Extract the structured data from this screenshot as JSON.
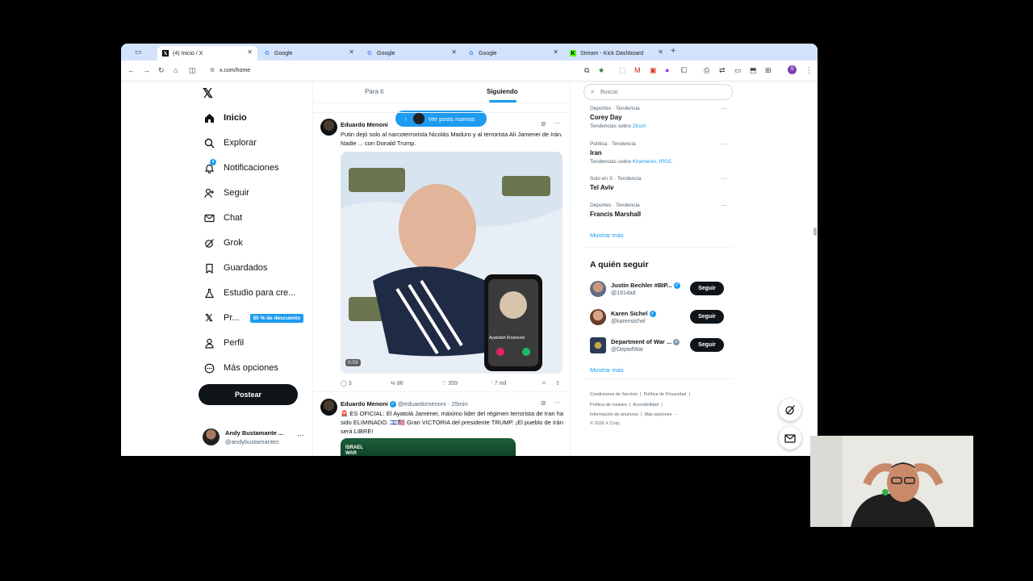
{
  "browser": {
    "tabs": [
      {
        "label": "(4) Inicio / X",
        "icon": "x-logo-icon",
        "active": true
      },
      {
        "label": "Google",
        "icon": "google-icon"
      },
      {
        "label": "Google",
        "icon": "google-icon"
      },
      {
        "label": "Google",
        "icon": "google-icon"
      },
      {
        "label": "Stream - Kick Dashboard",
        "icon": "kick-icon"
      }
    ],
    "url": "x.com/home",
    "profile_initial": "S"
  },
  "timeline": {
    "tab_for_you": "Para ti",
    "tab_following": "Siguiendo",
    "new_posts_pill": "Ver posts nuevos"
  },
  "nav": {
    "items": [
      "Inicio",
      "Explorar",
      "Notificaciones",
      "Seguir",
      "Chat",
      "Grok",
      "Guardados",
      "Estudio para cre...",
      "Pr...",
      "Perfil",
      "Más opciones"
    ],
    "notifications_badge": "4",
    "premium_badge": "50 % de descuento",
    "post_button": "Postear",
    "account_name": "Andy Bustamante ...",
    "account_handle": "@andybustamantec"
  },
  "post1": {
    "author": "Eduardo Menoni",
    "text": "Putin dejó solo al narcoterrorista Nicolás Maduro y al terrorista Ali Jamenei de Irán. Nadie ... con Donald Trump.",
    "video_time": "0:03",
    "phone_caller": "Ayatollah Khamenei",
    "replies": "3",
    "reposts": "86",
    "likes": "359",
    "views": "7 mil"
  },
  "post2": {
    "author": "Eduardo Menoni",
    "handle": "@eduardomenoni · 25min",
    "text": "🚨 ES OFICIAL: El Ayatolá Jamenei,  máximo lider del régimen terrorista de Iran ha sido ELIMINADO. 🇮🇱🇺🇸 Gran VICTORIA del presidente TRUMP. ¡El pueblo de Irán será LIBRE!",
    "image_label": "ISRAEL WAR ROOM"
  },
  "search": {
    "placeholder": "Buscar"
  },
  "trends": [
    {
      "meta": "Deportes · Tendencia",
      "name": "Corey Day",
      "sub_prefix": "Tendencias sobre ",
      "sub_links": "Zlisch"
    },
    {
      "meta": "Política · Tendencia",
      "name": "Iran",
      "sub_prefix": "Tendencias sobre ",
      "sub_links": "Khamenei, IRGC"
    },
    {
      "meta": "Solo en X · Tendencia",
      "name": "Tel Aviv",
      "sub_prefix": "",
      "sub_links": ""
    },
    {
      "meta": "Deportes · Tendencia",
      "name": "Francis Marshall",
      "sub_prefix": "",
      "sub_links": ""
    }
  ],
  "trends_show_more": "Mostrar más",
  "who_to_follow": {
    "title": "A quién seguir",
    "users": [
      {
        "name": "Justin Bechler #BIP...",
        "handle": "@1914ad",
        "button": "Seguir"
      },
      {
        "name": "Karen Sichel",
        "handle": "@karensichel",
        "button": "Seguir"
      },
      {
        "name": "Department of War ...",
        "handle": "@DeptofWar",
        "button": "Seguir"
      }
    ],
    "show_more": "Mostrar más"
  },
  "footer": {
    "line1": [
      "Condiciones de Servicio",
      "Política de Privacidad",
      "Política de cookies",
      "Accesibilidad"
    ],
    "line2": [
      "Información de anuncios",
      "Más opciones ···"
    ],
    "copyright": "© 2026 X Corp."
  },
  "colors": {
    "accent": "#1d9bf0",
    "tabstrip": "#d3e3fd",
    "text": "#0f1419",
    "muted": "#536471"
  }
}
